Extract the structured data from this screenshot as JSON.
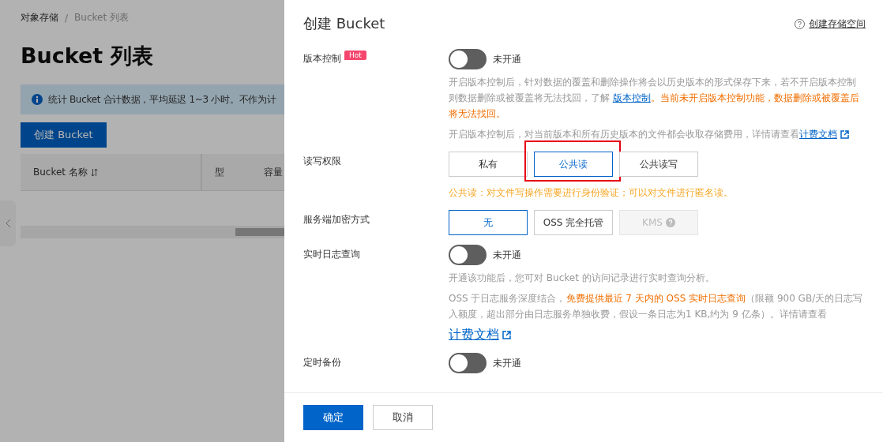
{
  "background_page": {
    "breadcrumb": [
      "对象存储",
      "Bucket 列表"
    ],
    "breadcrumb_separator": "/",
    "title": "Bucket 列表",
    "notice": "统计 Bucket 合计数据，平均延迟 1~3 小时。不作为计",
    "create_button": "创建 Bucket",
    "table": {
      "columns": [
        "Bucket 名称",
        "型",
        "容量"
      ]
    }
  },
  "drawer": {
    "title": "创建 Bucket",
    "help_link": "创建存储空间",
    "sections": [
      {
        "kind": "switch",
        "label": "版本控制",
        "badge": "Hot",
        "on": false,
        "state_text": "未开通",
        "notes": [
          [
            {
              "kind": "plain",
              "text": "开启版本控制后，针对数据的覆盖和删除操作将会以历史版本的形式保存下来，若不开启版本控制则数据删除或被覆盖将无法找回，了解 "
            },
            {
              "kind": "link",
              "text": "版本控制"
            },
            {
              "kind": "warning",
              "text": "。当前未开启版本控制功能，数据删除或被覆盖后将无法找回。"
            }
          ],
          [
            {
              "kind": "plain",
              "text": "开启版本控制后，对当前版本和所有历史版本的文件都会收取存储费用，详情请查看"
            },
            {
              "kind": "link",
              "text": "计费文档",
              "external": true
            }
          ]
        ]
      },
      {
        "kind": "choice",
        "label": "读写权限",
        "options": [
          {
            "label": "私有",
            "selected": false
          },
          {
            "label": "公共读",
            "selected": true,
            "highlighted": true
          },
          {
            "label": "公共读写",
            "selected": false
          }
        ],
        "hint": "公共读：对文件写操作需要进行身份验证；可以对文件进行匿名读。"
      },
      {
        "kind": "choice",
        "label": "服务端加密方式",
        "options": [
          {
            "label": "无",
            "selected": true
          },
          {
            "label": "OSS 完全托管",
            "selected": false
          },
          {
            "label": "KMS",
            "selected": false,
            "disabled": true
          }
        ]
      },
      {
        "kind": "switch",
        "label": "实时日志查询",
        "on": false,
        "state_text": "未开通",
        "notes": [
          [
            {
              "kind": "plain",
              "text": "开通该功能后，您可对 Bucket 的访问记录进行实时查询分析。"
            }
          ],
          [
            {
              "kind": "plain",
              "text": "OSS 于日志服务深度结合，"
            },
            {
              "kind": "warning",
              "text": "免费提供最近 7 天内的 OSS 实时日志查询"
            },
            {
              "kind": "plain",
              "text": "（限额 900 GB/天的日志写入额度，超出部分由日志服务单独收费，假设一条日志为1 KB,约为 9 亿条）。详情请查看"
            }
          ],
          [
            {
              "kind": "link",
              "text": "计费文档",
              "external": true
            }
          ]
        ]
      },
      {
        "kind": "switch",
        "label": "定时备份",
        "on": false,
        "state_text": "未开通"
      }
    ],
    "footer_buttons": [
      {
        "label": "确定",
        "primary": true
      },
      {
        "label": "取消",
        "primary": false
      }
    ]
  }
}
